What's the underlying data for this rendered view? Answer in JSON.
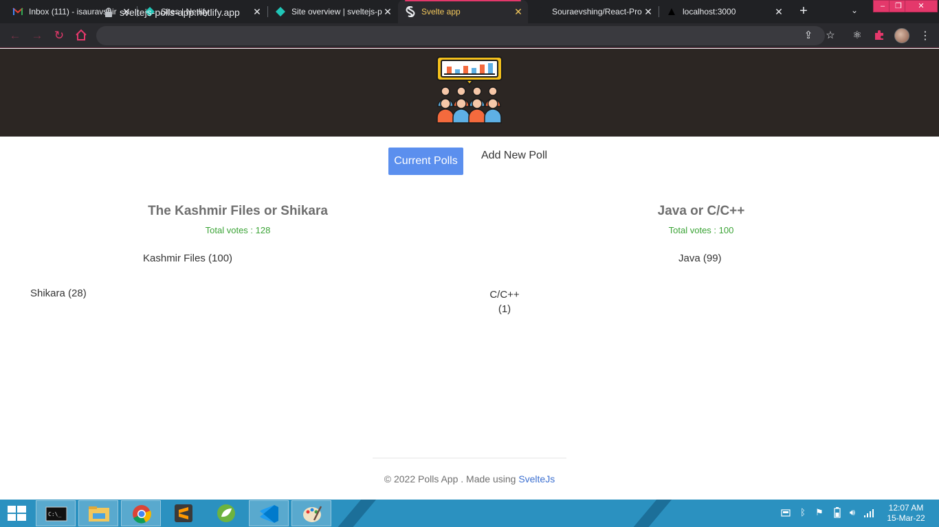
{
  "browser": {
    "tabs": [
      {
        "title": "Inbox (111) - isauravshir",
        "icon": "gmail-icon"
      },
      {
        "title": "Sites | Netlify",
        "icon": "netlify-icon"
      },
      {
        "title": "Site overview | sveltejs-p",
        "icon": "netlify-icon"
      },
      {
        "title": "Svelte app",
        "icon": "svelte-icon",
        "active": true
      },
      {
        "title": "Souraevshing/React-Pro",
        "icon": "github-icon"
      },
      {
        "title": "localhost:3000",
        "icon": "vercel-icon"
      }
    ],
    "new_tab_label": "+",
    "tab_menu_label": "⌄",
    "window_controls": {
      "minimize": "–",
      "maximize": "❐",
      "close": "✕"
    },
    "url": "sveltejs-polls-app.netlify.app",
    "accent_color": "#e4386b"
  },
  "app": {
    "nav": {
      "current_label": "Current Polls",
      "add_label": "Add New Poll"
    },
    "polls": [
      {
        "question": "The Kashmir Files or Shikara",
        "total": "Total votes : 128",
        "options": [
          {
            "label": "Kashmir Files (100)"
          },
          {
            "label": "Shikara (28)"
          }
        ]
      },
      {
        "question": "Java or C/C++",
        "total": "Total votes : 100",
        "options": [
          {
            "label": "Java (99)"
          },
          {
            "label_line1": "C/C++",
            "label_line2": "(1)"
          }
        ]
      }
    ],
    "footer": {
      "text": "© 2022 Polls App . Made using ",
      "link": "SvelteJs"
    }
  },
  "taskbar": {
    "apps": [
      "cmd-icon",
      "file-explorer-icon",
      "chrome-icon",
      "sublime-text-icon",
      "spring-icon",
      "vscode-icon",
      "paint-icon"
    ],
    "clock_time": "12:07 AM",
    "clock_date": "15-Mar-22",
    "color": "#2b91c0"
  }
}
